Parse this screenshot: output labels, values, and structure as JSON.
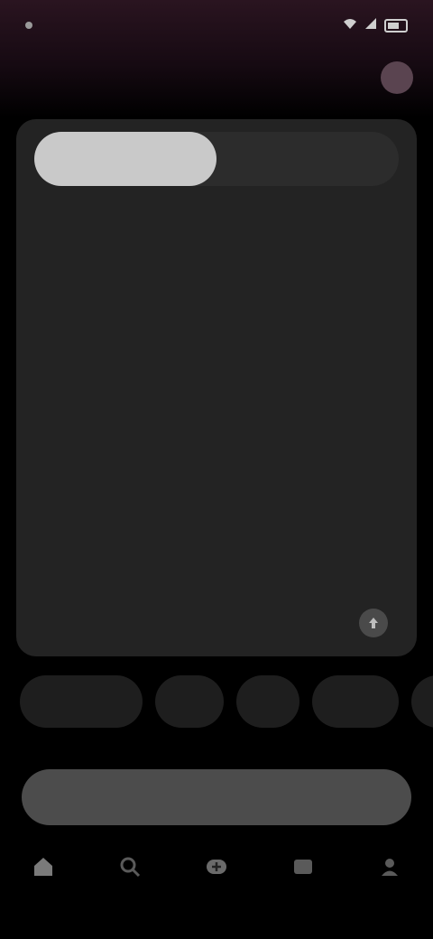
{
  "status_bar": {
    "time": "",
    "icons": [
      "wifi-icon",
      "signal-icon",
      "battery-icon"
    ]
  },
  "header": {
    "title": "",
    "action_label": ""
  },
  "card": {
    "toggle": {
      "active_label": "",
      "inactive_label": ""
    },
    "description": "",
    "footer_left": "",
    "footer_meta": ""
  },
  "chips": [
    {
      "label": ""
    },
    {
      "label": ""
    },
    {
      "label": ""
    },
    {
      "label": ""
    },
    {
      "label": ""
    }
  ],
  "cta_label": "",
  "nav": [
    {
      "icon": "home-icon",
      "label": ""
    },
    {
      "icon": "search-icon",
      "label": ""
    },
    {
      "icon": "create-icon",
      "label": ""
    },
    {
      "icon": "library-icon",
      "label": ""
    },
    {
      "icon": "profile-icon",
      "label": ""
    }
  ],
  "colors": {
    "accent_bg": "#2a1420",
    "card_bg": "#232323",
    "toggle_active": "#c9c9c9",
    "cta_bg": "#4c4c4c"
  }
}
